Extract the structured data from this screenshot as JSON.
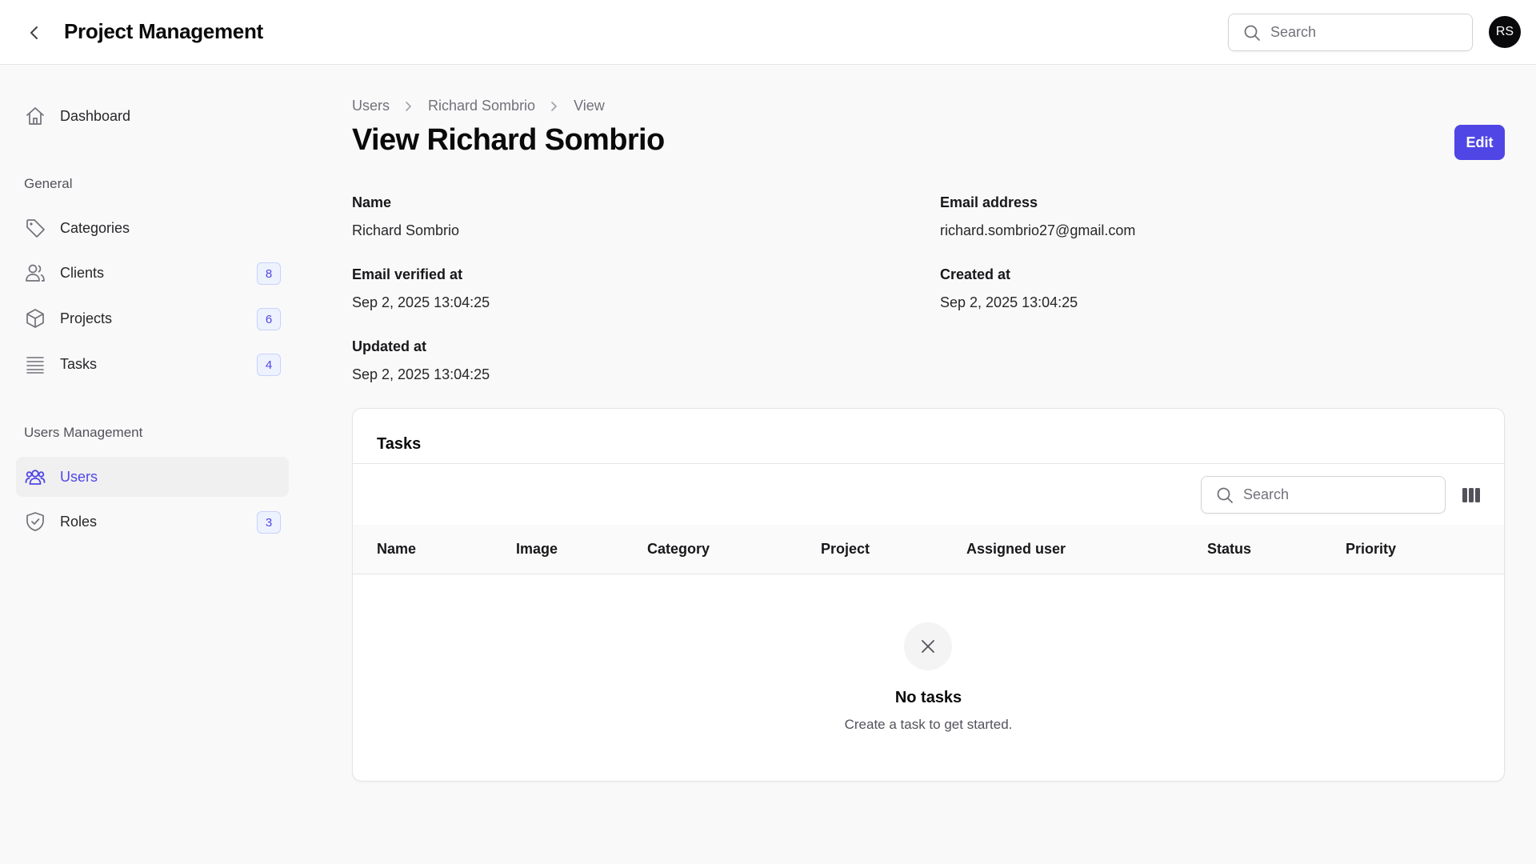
{
  "header": {
    "title": "Project Management",
    "search_placeholder": "Search",
    "avatar_initials": "RS"
  },
  "sidebar": {
    "dashboard": {
      "label": "Dashboard",
      "icon": "home-icon"
    },
    "groups": [
      {
        "label": "General"
      },
      {
        "label": "Users Management"
      }
    ],
    "items": [
      {
        "label": "Categories",
        "icon": "tag-icon",
        "badge": ""
      },
      {
        "label": "Clients",
        "icon": "users-icon",
        "badge": "8"
      },
      {
        "label": "Projects",
        "icon": "cube-icon",
        "badge": "6"
      },
      {
        "label": "Tasks",
        "icon": "list-icon",
        "badge": "4"
      },
      {
        "label": "Users",
        "icon": "user-group-icon",
        "badge": "",
        "active": true
      },
      {
        "label": "Roles",
        "icon": "shield-icon",
        "badge": "3"
      }
    ]
  },
  "breadcrumb": [
    "Users",
    "Richard Sombrio",
    "View"
  ],
  "page": {
    "title": "View Richard Sombrio",
    "edit_label": "Edit"
  },
  "fields": {
    "name": {
      "label": "Name",
      "value": "Richard Sombrio"
    },
    "email": {
      "label": "Email address",
      "value": "richard.sombrio27@gmail.com"
    },
    "email_verified": {
      "label": "Email verified at",
      "value": "Sep 2, 2025 13:04:25"
    },
    "created": {
      "label": "Created at",
      "value": "Sep 2, 2025 13:04:25"
    },
    "updated": {
      "label": "Updated at",
      "value": "Sep 2, 2025 13:04:25"
    }
  },
  "tasks_table": {
    "title": "Tasks",
    "search_placeholder": "Search",
    "columns": [
      "Name",
      "Image",
      "Category",
      "Project",
      "Assigned user",
      "Status",
      "Priority"
    ],
    "empty_title": "No tasks",
    "empty_subtitle": "Create a task to get started."
  },
  "colors": {
    "accent": "#4f46e5",
    "page_bg": "#f9f9f9"
  }
}
